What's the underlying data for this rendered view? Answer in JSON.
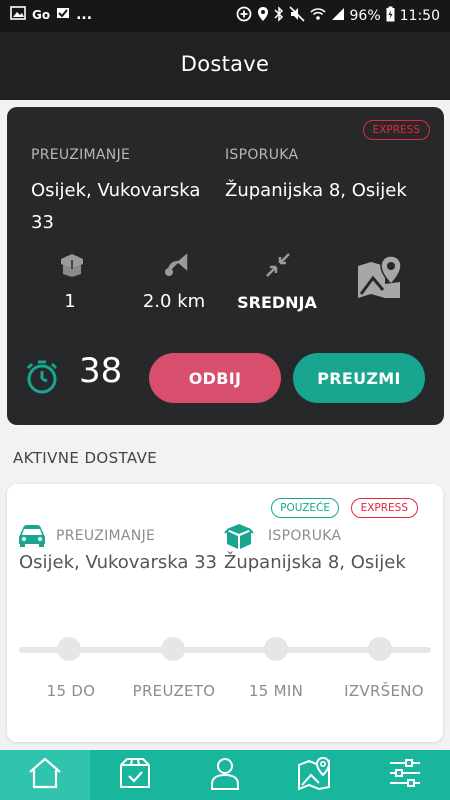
{
  "statusbar": {
    "left_icons": [
      "image-icon",
      "go-icon",
      "check-app-icon"
    ],
    "left_text_go": "Go",
    "left_more": "...",
    "battery_percent": "96%",
    "time": "11:50"
  },
  "appbar": {
    "title": "Dostave"
  },
  "offer": {
    "badge_express": "EXPRESS",
    "pickup_label": "PREUZIMANJE",
    "pickup_address": "Osijek, Vukovarska 33",
    "dropoff_label": "ISPORUKA",
    "dropoff_address": "Županijska 8, Osijek",
    "packages": "1",
    "distance": "2.0 km",
    "size": "SREDNJA",
    "timer": "38",
    "reject_label": "ODBIJ",
    "accept_label": "PREUZMI"
  },
  "section": {
    "title": "AKTIVNE DOSTAVE"
  },
  "active_delivery": {
    "badge_cod": "POUZEĆE",
    "badge_express": "EXPRESS",
    "pickup_label": "PREUZIMANJE",
    "pickup_address": "Osijek, Vukovarska 33",
    "dropoff_label": "ISPORUKA",
    "dropoff_address": "Županijska 8, Osijek",
    "steps": [
      "15 DO",
      "PREUZETO",
      "15 MIN",
      "IZVRŠENO"
    ]
  },
  "bottom_nav": {
    "items": [
      "home-icon",
      "box-check-icon",
      "user-icon",
      "map-icon",
      "sliders-icon"
    ],
    "active_index": 0
  },
  "colors": {
    "accent_teal": "#18a691",
    "reject_pink": "#d84f6d",
    "express_red": "#e8273d",
    "dark_card": "#26282a",
    "nav_teal": "#19b69e"
  }
}
